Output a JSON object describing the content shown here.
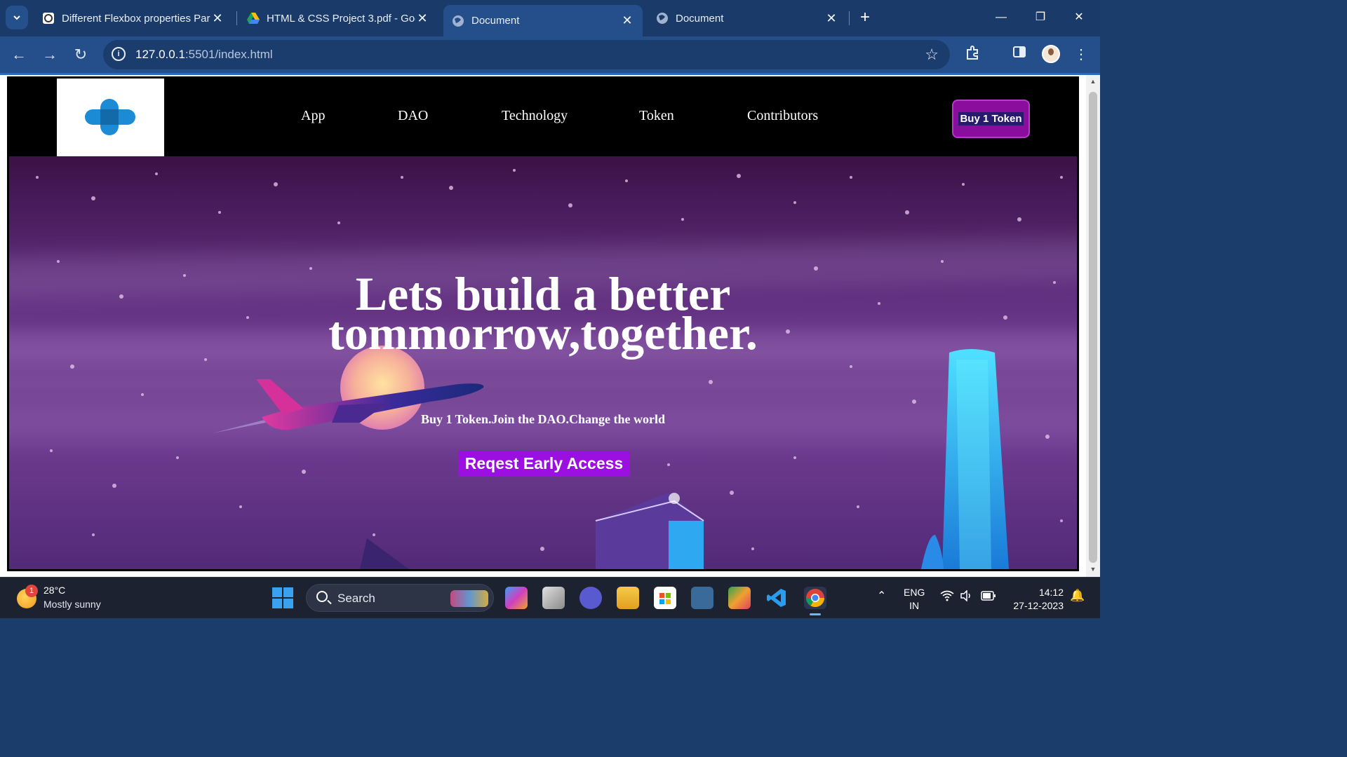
{
  "browser": {
    "tabs": [
      {
        "title": "Different Flexbox properties Par",
        "active": false
      },
      {
        "title": "HTML & CSS Project 3.pdf - Goo",
        "active": false
      },
      {
        "title": "Document",
        "active": true
      },
      {
        "title": "Document",
        "active": false
      }
    ],
    "url_host": "127.0.0.1",
    "url_path": ":5501/index.html"
  },
  "site": {
    "nav": [
      "App",
      "DAO",
      "Technology",
      "Token",
      "Contributors"
    ],
    "buy_button": "Buy 1 Token",
    "hero": {
      "title_line1": "Lets build a better",
      "title_line2": "tommorrow,together.",
      "subtitle": "Buy 1 Token.Join the DAO.Change the world",
      "cta": "Reqest Early Access"
    }
  },
  "taskbar": {
    "weather_badge": "1",
    "temperature": "28°C",
    "condition": "Mostly sunny",
    "search_label": "Search",
    "lang_line1": "ENG",
    "lang_line2": "IN",
    "time": "14:12",
    "date": "27-12-2023"
  },
  "colors": {
    "chrome_dark": "#1a3a6a",
    "chrome_toolbar": "#244f8b",
    "hero_purple": "#6e3a8e",
    "cta_purple": "#9b0fe0",
    "buy_button": "#8a0d9d"
  }
}
